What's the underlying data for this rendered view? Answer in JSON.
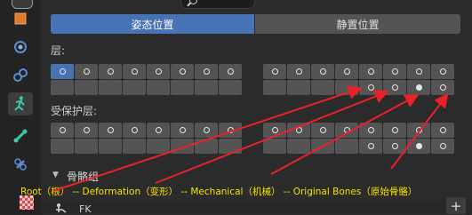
{
  "header": {
    "tabs": [
      {
        "label": "姿态位置",
        "active": true
      },
      {
        "label": "静置位置",
        "active": false
      }
    ]
  },
  "layers": {
    "label": "层:",
    "left_top": [
      true,
      true,
      true,
      true,
      true,
      true,
      true,
      true
    ],
    "left_bottom": [
      false,
      false,
      false,
      false,
      false,
      false,
      false,
      false
    ],
    "right_top": [
      true,
      true,
      true,
      true,
      true,
      true,
      true,
      true
    ],
    "right_bottom": [
      false,
      false,
      false,
      false,
      true,
      true,
      true,
      true
    ],
    "selected_left_top": 0,
    "filled_right_bottom": 6
  },
  "protected_layers": {
    "label": "受保护层:",
    "left_top": [
      true,
      true,
      true,
      true,
      true,
      true,
      true,
      true
    ],
    "left_bottom": [
      false,
      false,
      false,
      false,
      false,
      false,
      false,
      false
    ],
    "right_top": [
      true,
      true,
      true,
      true,
      true,
      true,
      true,
      true
    ],
    "right_bottom": [
      false,
      false,
      false,
      false,
      true,
      true,
      true,
      true
    ],
    "filled_right_bottom": 6
  },
  "bone_groups": {
    "section_label": "骨骼组",
    "annotation": "Root（根） -- Deformation（变形） -- Mechanical（机械） -- Original Bones（原始骨骼）",
    "items": [
      {
        "label": "FK"
      }
    ],
    "add_label": "+"
  },
  "colors": {
    "accent": "#4772b3",
    "annotation": "#f5e400",
    "arrow": "#e8212b"
  }
}
